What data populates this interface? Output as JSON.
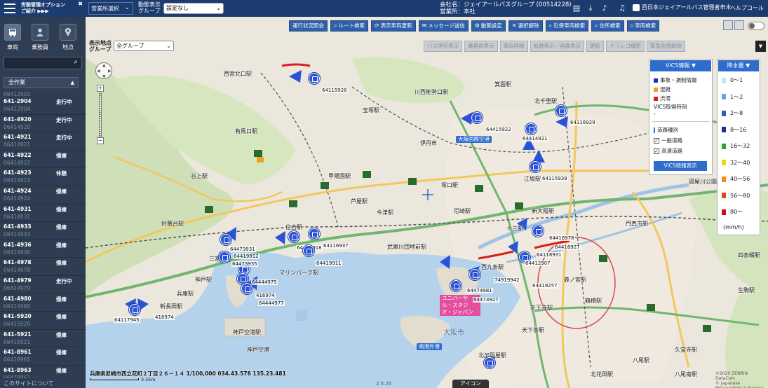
{
  "header": {
    "brand_line1": "労務管理オプション",
    "brand_line2": "ご紹介 ▶▶▶",
    "office_select": "営業所選択",
    "dyn_group_label_1": "動態表示",
    "dyn_group_label_2": "グループ",
    "dyn_group_value": "設定なし",
    "company_line1": "会社名：ジェイアールバスグループ (00514228)",
    "company_line2": "営業所：本社",
    "user": "西日本ジェイアールバス管理者市木",
    "help": "ヘルプ",
    "coral": "コール"
  },
  "sidebar": {
    "tabs": [
      {
        "label": "車両",
        "icon": "bus-icon"
      },
      {
        "label": "乗務員",
        "icon": "person-icon"
      },
      {
        "label": "地点",
        "icon": "pin-icon"
      }
    ],
    "filter": "全作業",
    "vehicles": [
      {
        "name": "641-2904",
        "id": "06412904",
        "status": "走行中"
      },
      {
        "name": "641-4920",
        "id": "06414920",
        "status": "走行中"
      },
      {
        "name": "641-4921",
        "id": "06414921",
        "status": "走行中"
      },
      {
        "name": "641-4922",
        "id": "06414922",
        "status": "帰庫"
      },
      {
        "name": "641-4923",
        "id": "06414923",
        "status": "休憩"
      },
      {
        "name": "641-4924",
        "id": "06414924",
        "status": "帰庫"
      },
      {
        "name": "641-4931",
        "id": "06414931",
        "status": "帰庫"
      },
      {
        "name": "641-4933",
        "id": "06414933",
        "status": "帰庫"
      },
      {
        "name": "641-4936",
        "id": "06414936",
        "status": "帰庫"
      },
      {
        "name": "641-4978",
        "id": "06414978",
        "status": "帰庫"
      },
      {
        "name": "641-4979",
        "id": "06414979",
        "status": "走行中"
      },
      {
        "name": "641-4980",
        "id": "06414980",
        "status": "帰庫"
      },
      {
        "name": "641-5920",
        "id": "06415920",
        "status": "帰庫"
      },
      {
        "name": "641-5921",
        "id": "06415921",
        "status": "帰庫"
      },
      {
        "name": "641-8961",
        "id": "06418961",
        "status": "帰庫"
      },
      {
        "name": "641-8963",
        "id": "06418963",
        "status": "帰庫"
      }
    ],
    "top_partial_id": "06412903",
    "about": "このサイトについて"
  },
  "toolbar": {
    "buttons": [
      {
        "label": "運行状況照会",
        "icon": ""
      },
      {
        "label": "ルート検索",
        "icon": "search-icon"
      },
      {
        "label": "表示車両更新",
        "icon": "refresh-icon"
      },
      {
        "label": "メッセージ送信",
        "icon": "mail-icon"
      },
      {
        "label": "動態設定",
        "icon": "gear-icon"
      },
      {
        "label": "選択解除",
        "icon": "clear-icon"
      },
      {
        "label": "近傍車両検索",
        "icon": "search-icon"
      },
      {
        "label": "住所検索",
        "icon": "search-icon"
      },
      {
        "label": "車両検索",
        "icon": "search-icon"
      }
    ]
  },
  "map_bar": {
    "label_1": "表示地点",
    "label_2": "グループ",
    "group_value": "全グループ",
    "buttons": [
      "バス停名表示",
      "乗務員表示",
      "車両詳細",
      "軌跡表示／画像表示",
      "更新",
      "ドラレコ撮影",
      "緊急状態解除"
    ]
  },
  "vics": {
    "title": "VICS情報",
    "legend": [
      {
        "label": "事象・規制情報",
        "color": "#1a2fbf"
      },
      {
        "label": "混雑",
        "color": "#f0a020"
      },
      {
        "label": "渋滞",
        "color": "#d81e1e"
      }
    ],
    "time_label": "VICS取得時刻",
    "time_value": "-",
    "road_type": "道路種別",
    "checks": [
      {
        "label": "一般道路",
        "checked": true
      },
      {
        "label": "高速道路",
        "checked": true
      }
    ],
    "button": "VICS情報表示"
  },
  "rain": {
    "title": "降水量",
    "levels": [
      {
        "label": "0〜1",
        "color": "#bfe6f2"
      },
      {
        "label": "1〜2",
        "color": "#5aa8e8"
      },
      {
        "label": "2〜8",
        "color": "#2f5cc8"
      },
      {
        "label": "8〜16",
        "color": "#1f2f9a"
      },
      {
        "label": "16〜32",
        "color": "#30a030"
      },
      {
        "label": "32〜40",
        "color": "#f2d020"
      },
      {
        "label": "40〜56",
        "color": "#f08a20"
      },
      {
        "label": "56〜80",
        "color": "#e04a1a"
      },
      {
        "label": "80〜",
        "color": "#c81010"
      }
    ],
    "unit": "(mm/h)"
  },
  "map": {
    "places": [
      {
        "name": "西宮北口駅"
      },
      {
        "name": "川西能勢口駅"
      },
      {
        "name": "箕面駅"
      },
      {
        "name": "宝塚駅"
      },
      {
        "name": "大阪国際空港"
      },
      {
        "name": "伊丹市"
      },
      {
        "name": "北千里駅"
      },
      {
        "name": "有馬口駅"
      },
      {
        "name": "甲陽園駅"
      },
      {
        "name": "塚口駅"
      },
      {
        "name": "江坂駅"
      },
      {
        "name": "谷上駅"
      },
      {
        "name": "新大阪駅"
      },
      {
        "name": "芦屋駅"
      },
      {
        "name": "今津駅"
      },
      {
        "name": "尼崎駅"
      },
      {
        "name": "十三駅"
      },
      {
        "name": "鈴蘭台駅"
      },
      {
        "name": "住吉駅"
      },
      {
        "name": "武庫川団地前駅"
      },
      {
        "name": "三宮駅"
      },
      {
        "name": "マリンパーク駅"
      },
      {
        "name": "神戸駅"
      },
      {
        "name": "西九条駅"
      },
      {
        "name": "兵庫駅"
      },
      {
        "name": "新長田駅"
      },
      {
        "name": "森ノ宮駅"
      },
      {
        "name": "ユニバーサル・スタジオ・ジャパン"
      },
      {
        "name": "神戸空港駅"
      },
      {
        "name": "天下茶駅"
      },
      {
        "name": "大阪市"
      },
      {
        "name": "南港外港"
      },
      {
        "name": "北加賀屋駅"
      },
      {
        "name": "久宝寺駅"
      },
      {
        "name": "八尾南駅"
      },
      {
        "name": "門真市駅"
      },
      {
        "name": "寝屋川公園駅"
      },
      {
        "name": "四条畷駅"
      },
      {
        "name": "生駒駅"
      },
      {
        "name": "八尾駅"
      },
      {
        "name": "鶴橋駅"
      },
      {
        "name": "天王寺駅"
      },
      {
        "name": "北花田駅"
      },
      {
        "name": "神戸空港"
      }
    ],
    "vehicle_labels": [
      "64115928",
      "64116929",
      "64415922",
      "64414921",
      "64115939",
      "64416978",
      "64419912",
      "64419918",
      "64116937",
      "64419911",
      "64473931",
      "64473935",
      "64444975",
      "416974",
      "64444977",
      "64117945",
      "418974",
      "64474981",
      "64412907",
      "64473927",
      "64416927",
      "74919942",
      "64419257",
      "64118931"
    ],
    "address": "兵庫県尼崎市西立花町２丁目２６－１４ 1/100,000 034.43.578 135.23.481",
    "scale": "3.5km",
    "version": "2.5.25",
    "icon_tab": "アイコン",
    "copyright_1": "©2020 ZENRIN DataCom",
    "copyright_2": "© Japanese Meteorological Agency"
  }
}
